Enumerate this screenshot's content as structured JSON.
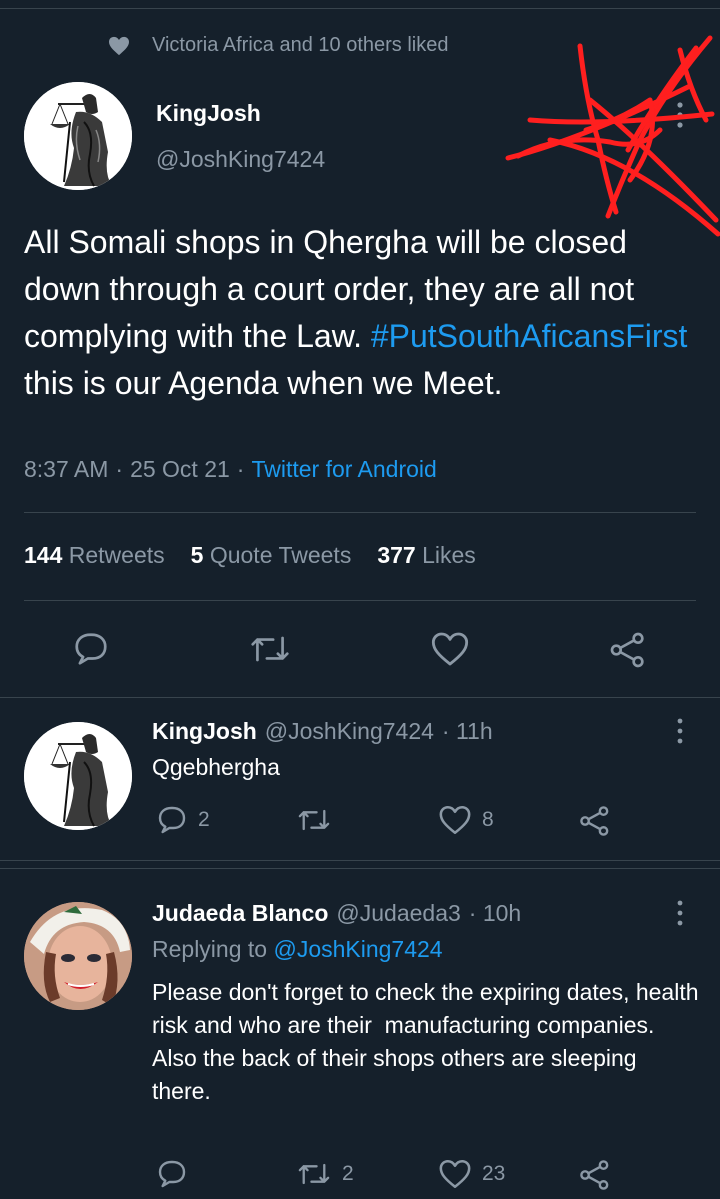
{
  "social_context": {
    "text": "Victoria Africa and 10 others liked"
  },
  "main_tweet": {
    "author_name": "KingJosh",
    "author_handle": "@JoshKing7424",
    "text_before": "All Somali shops in Qhergha will be closed down through a court order, they are all not complying with the Law. ",
    "hashtag": "#PutSouthAficansFirst",
    "text_after": " this is our Agenda when we Meet.",
    "time": "8:37 AM",
    "sep1": "·",
    "date": "25 Oct 21",
    "sep2": "·",
    "source": "Twitter for Android",
    "stats": {
      "retweets_count": "144",
      "retweets_label": "Retweets",
      "quotes_count": "5",
      "quotes_label": "Quote Tweets",
      "likes_count": "377",
      "likes_label": "Likes"
    }
  },
  "replies": [
    {
      "author_name": "KingJosh",
      "author_handle": "@JoshKing7424",
      "time": "· 11h",
      "text": "Qgebhergha",
      "reply_count": "2",
      "retweet_count": "",
      "like_count": "8"
    },
    {
      "author_name": "Judaeda Blanco",
      "author_handle": "@Judaeda3",
      "time": "· 10h",
      "replying_prefix": "Replying to",
      "replying_to": "@JoshKing7424",
      "text_p1": "Please don't forget to check the expiring dates, health risk and who are their  manufacturing companies.",
      "text_p2": "Also the back of their shops others are sleeping there.",
      "reply_count": "",
      "retweet_count": "2",
      "like_count": "23"
    }
  ],
  "colors": {
    "background": "#15202b",
    "text": "#ffffff",
    "muted": "#8b98a5",
    "link": "#1d9bf0",
    "divider": "#38444d",
    "scribble": "#ff1f1f"
  },
  "icons": [
    "heart-icon",
    "more-icon",
    "reply-icon",
    "retweet-icon",
    "like-icon",
    "share-icon"
  ]
}
